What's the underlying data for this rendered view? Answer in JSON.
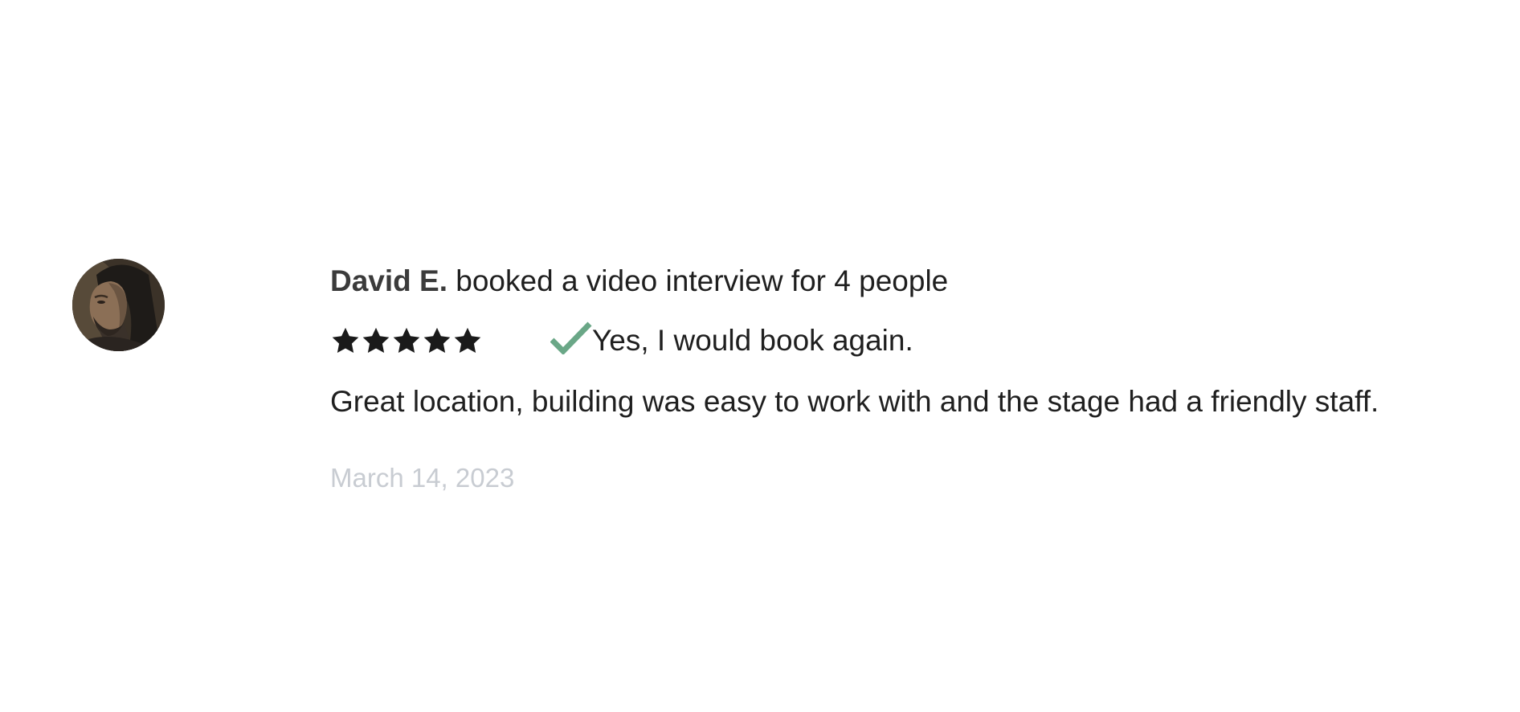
{
  "review": {
    "reviewer_name": "David E.",
    "booking_summary": "booked a video interview for 4 people",
    "rating": {
      "value": 5,
      "max": 5
    },
    "recommend_text": "Yes, I would book again.",
    "body": "Great location, building was easy to work with and the stage had a friendly staff.",
    "date": "March 14, 2023"
  },
  "icons": {
    "star": "star-icon",
    "check": "checkmark-icon",
    "avatar": "reviewer-avatar-photo"
  },
  "colors": {
    "text": "#1f1f1f",
    "name": "#3b3b3b",
    "star": "#1a1a1a",
    "check": "#6aa787",
    "date": "#c8ccd2",
    "background": "#ffffff"
  }
}
